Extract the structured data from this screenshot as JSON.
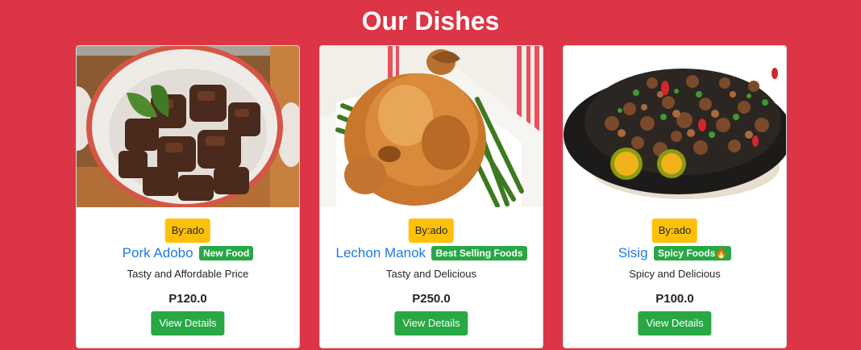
{
  "page": {
    "heading": "Our Dishes"
  },
  "colors": {
    "background": "#dc3545",
    "author_badge": "#ffc107",
    "tag_badge": "#28a745",
    "button": "#28a745",
    "dish_name": "#1f7ae0"
  },
  "dishes": [
    {
      "author": "By:ado",
      "name": "Pork Adobo",
      "tag": "New Food",
      "description": "Tasty and Affordable Price",
      "price": "P120.0",
      "button_label": "View Details",
      "image": "pork-adobo-photo"
    },
    {
      "author": "By:ado",
      "name": "Lechon Manok",
      "tag": "Best Selling Foods",
      "description": "Tasty and Delicious",
      "price": "P250.0",
      "button_label": "View Details",
      "image": "lechon-manok-photo"
    },
    {
      "author": "By:ado",
      "name": "Sisig",
      "tag": "Spicy Foods🔥",
      "description": "Spicy and Delicious",
      "price": "P100.0",
      "button_label": "View Details",
      "image": "sisig-photo"
    }
  ]
}
